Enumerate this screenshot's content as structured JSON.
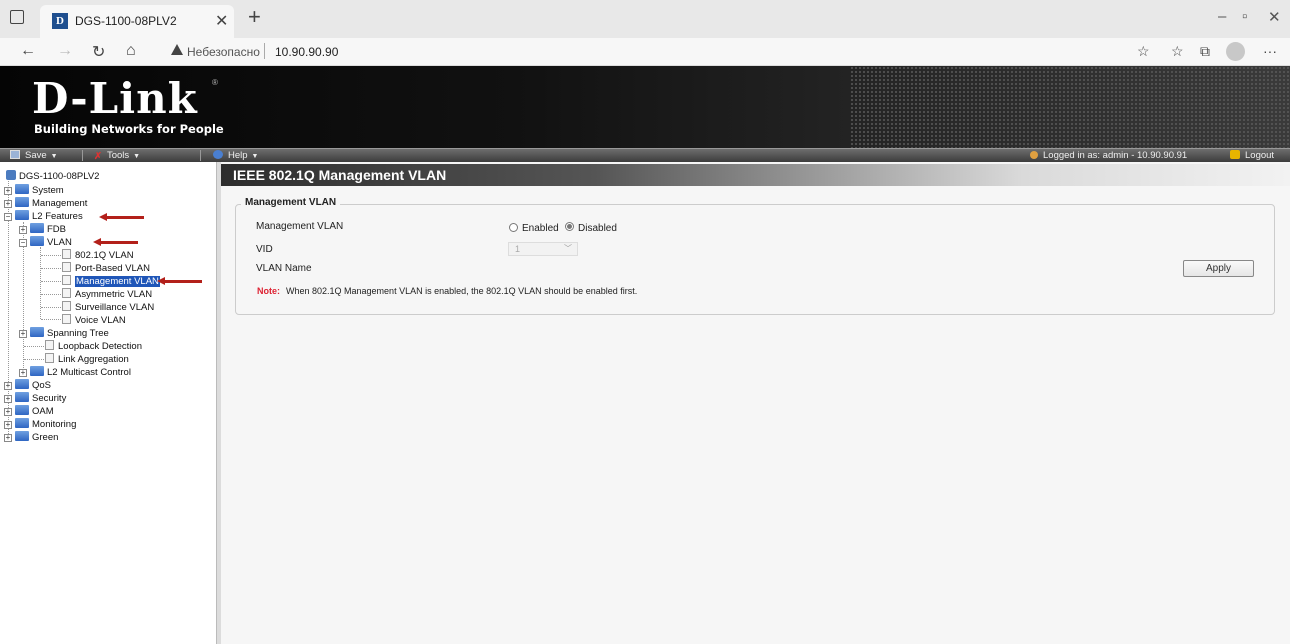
{
  "browser": {
    "tab_title": "DGS-1100-08PLV2",
    "tab_favicon_letter": "D",
    "security_warning": "Небезопасно",
    "url": "10.90.90.90"
  },
  "header": {
    "logo": "D-Link",
    "tagline": "Building Networks for People"
  },
  "toolbar": {
    "save": "Save",
    "tools": "Tools",
    "help": "Help",
    "logged_in": "Logged in as: admin - 10.90.90.91",
    "logout": "Logout"
  },
  "tree": {
    "root": "DGS-1100-08PLV2",
    "system": "System",
    "management": "Management",
    "l2_features": "L2 Features",
    "fdb": "FDB",
    "vlan": "VLAN",
    "vlan_8021q": "802.1Q VLAN",
    "port_based_vlan": "Port-Based VLAN",
    "management_vlan": "Management VLAN",
    "asymmetric_vlan": "Asymmetric VLAN",
    "surveillance_vlan": "Surveillance VLAN",
    "voice_vlan": "Voice VLAN",
    "spanning_tree": "Spanning Tree",
    "loopback_detection": "Loopback Detection",
    "link_aggregation": "Link Aggregation",
    "l2_multicast_control": "L2 Multicast Control",
    "qos": "QoS",
    "security": "Security",
    "oam": "OAM",
    "monitoring": "Monitoring",
    "green": "Green"
  },
  "main": {
    "title": "IEEE 802.1Q Management VLAN",
    "legend": "Management VLAN",
    "mgmt_vlan_label": "Management VLAN",
    "enabled_label": "Enabled",
    "disabled_label": "Disabled",
    "selected_state": "Disabled",
    "vid_label": "VID",
    "vid_value": "1",
    "vlan_name_label": "VLAN Name",
    "apply": "Apply",
    "note_label": "Note:",
    "note_text": "When 802.1Q Management VLAN is enabled, the 802.1Q VLAN should be enabled first."
  },
  "colors": {
    "annotation_arrow": "#b3201a",
    "tree_selection": "#1f56b8",
    "note_label": "#dd2233"
  }
}
